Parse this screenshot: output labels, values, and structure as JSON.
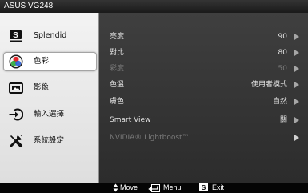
{
  "title": "ASUS VG248",
  "colors": {
    "titlebar": "#1a1a1a",
    "sidebar": "#dedede",
    "panel": "#2c2c2c",
    "text_active": "#e4e4e4",
    "text_disabled": "#7a7a7a",
    "footer": "#050505",
    "selected_bg": "#ffffff",
    "arrow": "#a6a6a6"
  },
  "sidebar": {
    "items": [
      {
        "label": "Splendid",
        "icon": "splendid-icon",
        "icon_letter": "S",
        "selected": false
      },
      {
        "label": "色彩",
        "icon": "color-icon",
        "selected": true
      },
      {
        "label": "影像",
        "icon": "image-icon",
        "selected": false
      },
      {
        "label": "輸入選擇",
        "icon": "input-select-icon",
        "selected": false
      },
      {
        "label": "系統設定",
        "icon": "system-setup-icon",
        "selected": false
      }
    ]
  },
  "settings": [
    {
      "label": "亮度",
      "value": "90",
      "disabled": false
    },
    {
      "label": "對比",
      "value": "80",
      "disabled": false
    },
    {
      "label": "彩度",
      "value": "50",
      "disabled": true
    },
    {
      "label": "色溫",
      "value": "使用者模式",
      "disabled": false
    },
    {
      "label": "膚色",
      "value": "自然",
      "disabled": false
    },
    {
      "label": "Smart View",
      "value": "關",
      "disabled": false
    },
    {
      "label": "NVIDIA® Lightboost™",
      "disabled": true
    }
  ],
  "footer": {
    "move_icon": "up-down-arrows-icon",
    "move": "Move",
    "menu_icon": "menu-enter-icon",
    "menu": "Menu",
    "exit_key": "S",
    "exit": "Exit"
  }
}
